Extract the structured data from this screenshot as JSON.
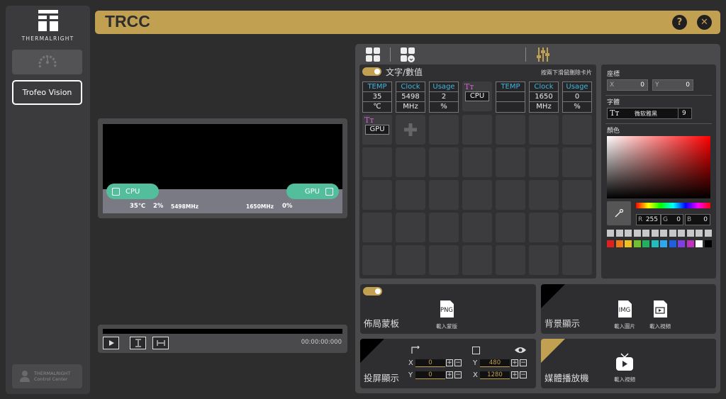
{
  "app": {
    "title": "TRCC",
    "brand": "THERMALRIGHT",
    "accent": "#c2a052"
  },
  "sidebar": {
    "device_label": "Trofeo Vision",
    "control_center": [
      "THERMALRIGHT",
      "Control Center"
    ]
  },
  "titlebar": {
    "help": "?",
    "close": "✕"
  },
  "preview": {
    "cpu_label": "CPU",
    "gpu_label": "GPU",
    "cpu_temp": "35℃",
    "cpu_usage": "2%",
    "cpu_clock": "5498MHz",
    "gpu_clock": "1650MHz",
    "gpu_usage": "0%",
    "pill_color": "#52be9c"
  },
  "player": {
    "time": "00:00:00:000"
  },
  "grid": {
    "title": "文字/數值",
    "hint": "按兩下滑鼠刪除卡片",
    "items": [
      {
        "header": "TEMP",
        "value": "35",
        "unit": "℃"
      },
      {
        "header": "Clock",
        "value": "5498",
        "unit": "MHz"
      },
      {
        "header": "Usage",
        "value": "2",
        "unit": "%"
      },
      {
        "header": "TEMP",
        "value": "",
        "unit": ""
      },
      {
        "header": "Clock",
        "value": "1650",
        "unit": "MHz"
      },
      {
        "header": "Usage",
        "value": "0",
        "unit": "%"
      }
    ],
    "text_cards": [
      "CPU",
      "GPU"
    ]
  },
  "props": {
    "position_label": "座標",
    "x_label": "X",
    "x_value": "0",
    "y_label": "Y",
    "y_value": "0",
    "font_label": "字體",
    "font_name": "微软雅黑",
    "font_size": "9",
    "color_label": "顏色",
    "r_label": "R",
    "r_value": "255",
    "g_label": "G",
    "g_value": "0",
    "b_label": "B",
    "b_value": "0",
    "swatches_gray": [
      "#c8c8c8",
      "#c8c8c8",
      "#c8c8c8",
      "#c8c8c8",
      "#c8c8c8",
      "#c8c8c8",
      "#c8c8c8",
      "#c8c8c8",
      "#c8c8c8",
      "#c8c8c8",
      "#c8c8c8",
      "#c8c8c8"
    ],
    "swatches_color": [
      "#e02020",
      "#f07818",
      "#f0c020",
      "#70c030",
      "#20b060",
      "#20c0c0",
      "#2aa8f0",
      "#2060e0",
      "#8040e0",
      "#c030c0",
      "#ffffff",
      "#000000"
    ]
  },
  "cards": {
    "layout_mask": {
      "title": "佈局蒙板",
      "action": "載入蒙版",
      "icon": "PNG"
    },
    "background": {
      "title": "背景顯示",
      "load_image": "載入圖片",
      "load_video": "載入視頻",
      "icon": "IMG"
    },
    "screencast": {
      "title": "投屏顯示",
      "x_label": "X",
      "x_value": "0",
      "y_label": "Y",
      "y_value": "0",
      "w_label": "Y",
      "w_value": "480",
      "h_label": "X",
      "h_value": "1280"
    },
    "media": {
      "title": "媒體播放機",
      "action": "載入視頻"
    }
  }
}
